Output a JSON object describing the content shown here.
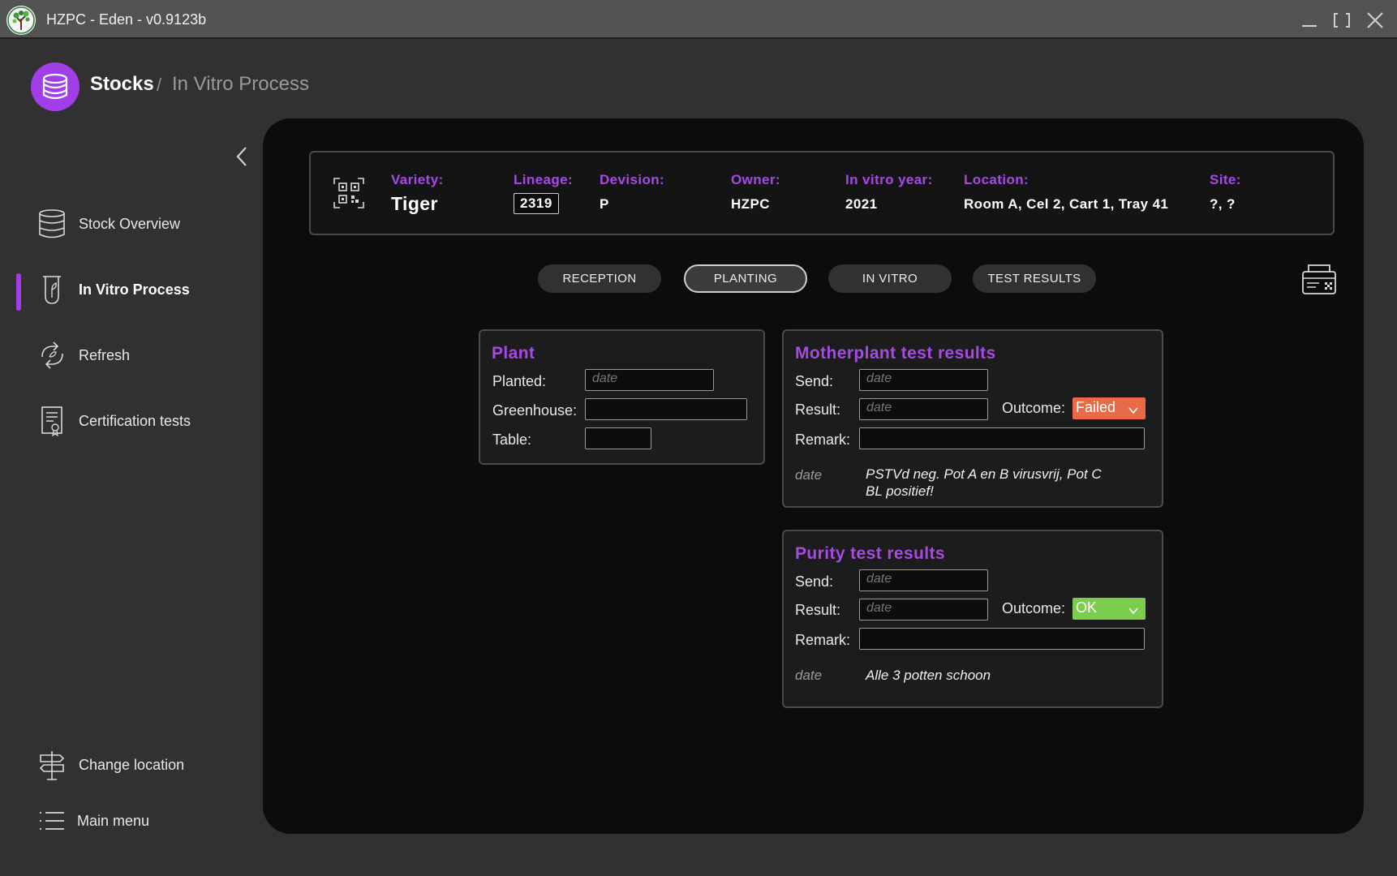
{
  "window": {
    "title": "HZPC - Eden - v0.9123b"
  },
  "breadcrumb": {
    "main": "Stocks",
    "separator": "/",
    "sub": "In Vitro Process"
  },
  "sidebar": {
    "items": [
      {
        "label": "Stock Overview",
        "icon": "database-icon"
      },
      {
        "label": "In Vitro Process",
        "icon": "test-tube-icon",
        "active": true
      },
      {
        "label": "Refresh",
        "icon": "refresh-icon"
      },
      {
        "label": "Certification tests",
        "icon": "certificate-icon"
      }
    ],
    "bottom": [
      {
        "label": "Change location",
        "icon": "signpost-icon"
      },
      {
        "label": "Main menu",
        "icon": "list-icon"
      }
    ]
  },
  "info": {
    "variety_label": "Variety:",
    "variety": "Tiger",
    "lineage_label": "Lineage:",
    "lineage": "2319",
    "division_label": "Devision:",
    "division": "P",
    "owner_label": "Owner:",
    "owner": "HZPC",
    "year_label": "In vitro year:",
    "year": "2021",
    "location_label": "Location:",
    "location": "Room A, Cel 2, Cart 1, Tray 41",
    "site_label": "Site:",
    "site": "?, ?"
  },
  "tabs": [
    "RECEPTION",
    "PLANTING",
    "IN VITRO",
    "TEST RESULTS"
  ],
  "active_tab": "PLANTING",
  "plant": {
    "title": "Plant",
    "planted_label": "Planted:",
    "planted_placeholder": "date",
    "greenhouse_label": "Greenhouse:",
    "greenhouse_value": "",
    "table_label": "Table:",
    "table_value": ""
  },
  "motherplant": {
    "title": "Motherplant test results",
    "send_label": "Send:",
    "send_placeholder": "date",
    "result_label": "Result:",
    "result_placeholder": "date",
    "outcome_label": "Outcome:",
    "outcome": "Failed",
    "outcome_color": "#e86a48",
    "remark_label": "Remark:",
    "remark_value": "",
    "note_date": "date",
    "note_text_line1": "PSTVd neg. Pot A en B virusvrij, Pot C",
    "note_text_line2": "BL positief!"
  },
  "purity": {
    "title": "Purity test results",
    "send_label": "Send:",
    "send_placeholder": "date",
    "result_label": "Result:",
    "result_placeholder": "date",
    "outcome_label": "Outcome:",
    "outcome": "OK",
    "outcome_color": "#7ccc4e",
    "remark_label": "Remark:",
    "remark_value": "",
    "note_date": "date",
    "note_text": "Alle 3 potten schoon"
  },
  "colors": {
    "accent": "#a23ee8",
    "panel": "#0c0c0c",
    "background": "#313131"
  }
}
